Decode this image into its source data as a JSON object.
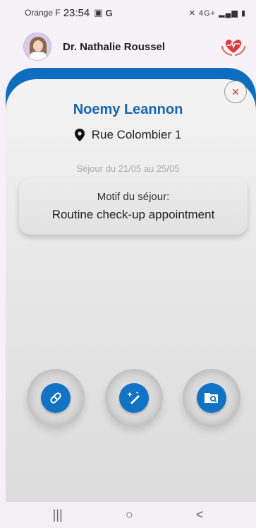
{
  "status_bar": {
    "carrier": "Orange F",
    "time": "23:54",
    "network": "4G+"
  },
  "header": {
    "doctor_name": "Dr. Nathalie Roussel"
  },
  "patient": {
    "name": "Noemy Leannon",
    "address": "Rue Colombier 1",
    "stay_dates": "Séjour du 21/05 au 25/05",
    "reason_label": "Motif du séjour:",
    "reason_value": "Routine check-up appointment"
  },
  "actions": [
    {
      "icon": "pill-icon"
    },
    {
      "icon": "magic-pen-icon"
    },
    {
      "icon": "folder-search-icon"
    }
  ],
  "nav": {
    "recents": "|||",
    "home": "○",
    "back": "<"
  },
  "colors": {
    "primary": "#1273c4",
    "frame": "#0d6dbf",
    "name": "#1565b0",
    "close": "#d03a3a"
  }
}
